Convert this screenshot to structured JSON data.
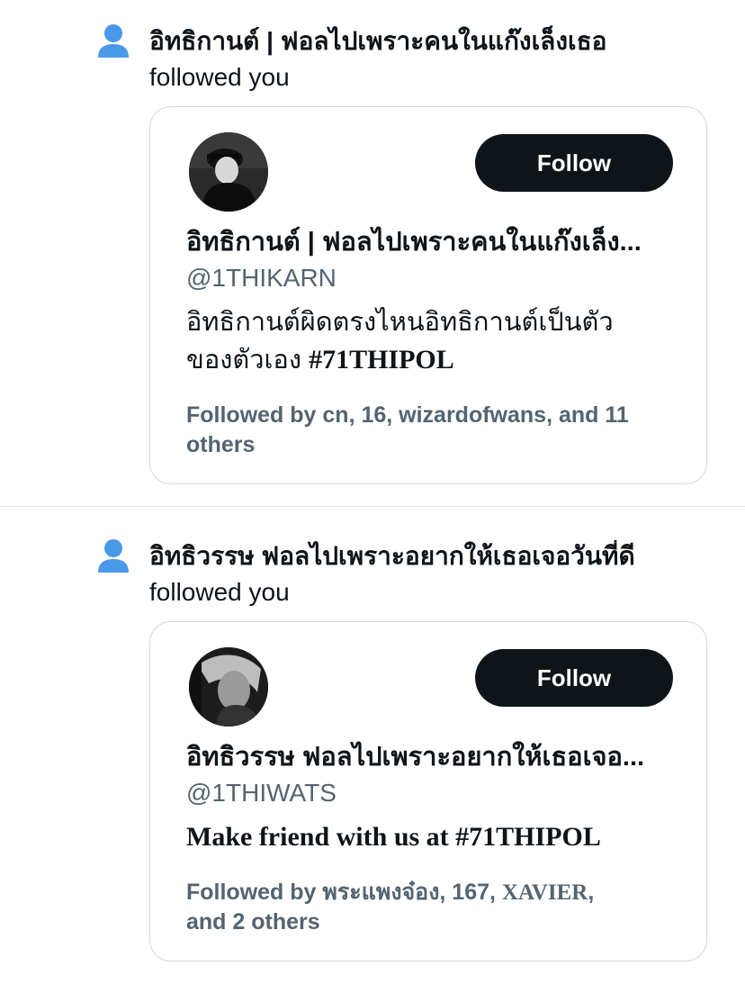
{
  "notifications": [
    {
      "title": "อิทธิกานต์ | ฟอลไปเพราะคนในแก๊งเล็งเธอ",
      "action": "followed you",
      "card": {
        "name": "อิทธิกานต์ | ฟอลไปเพราะคนในแก๊งเล็ง...",
        "handle": "@1THIKARN",
        "bio_line1": "อิทธิกานต์ผิดตรงไหนอิทธิกานต์เป็นตัว",
        "bio_line2_prefix": "ของตัวเอง ",
        "bio_line2_tag": "#71THIPOL",
        "followed_by": "Followed by cn, 16, wizardofwans, and 11 others",
        "follow_label": "Follow"
      }
    },
    {
      "title": "อิทธิวรรษ ฟอลไปเพราะอยากให้เธอเจอวันที่ดี",
      "action": "followed you",
      "card": {
        "name": "อิทธิวรรษ ฟอลไปเพราะอยากให้เธอเจอ...",
        "handle": "@1THIWATS",
        "bio": "Make friend with us at #71THIPOL",
        "followed_by_prefix": "Followed by พระแพงจ๋อง, 167, ",
        "followed_by_serif": "XAVIER",
        "followed_by_suffix": ",",
        "followed_by_line2": "and 2 others",
        "follow_label": "Follow"
      }
    }
  ],
  "icons": {
    "notification_type": "person-icon",
    "accent": "#4a99e9"
  }
}
